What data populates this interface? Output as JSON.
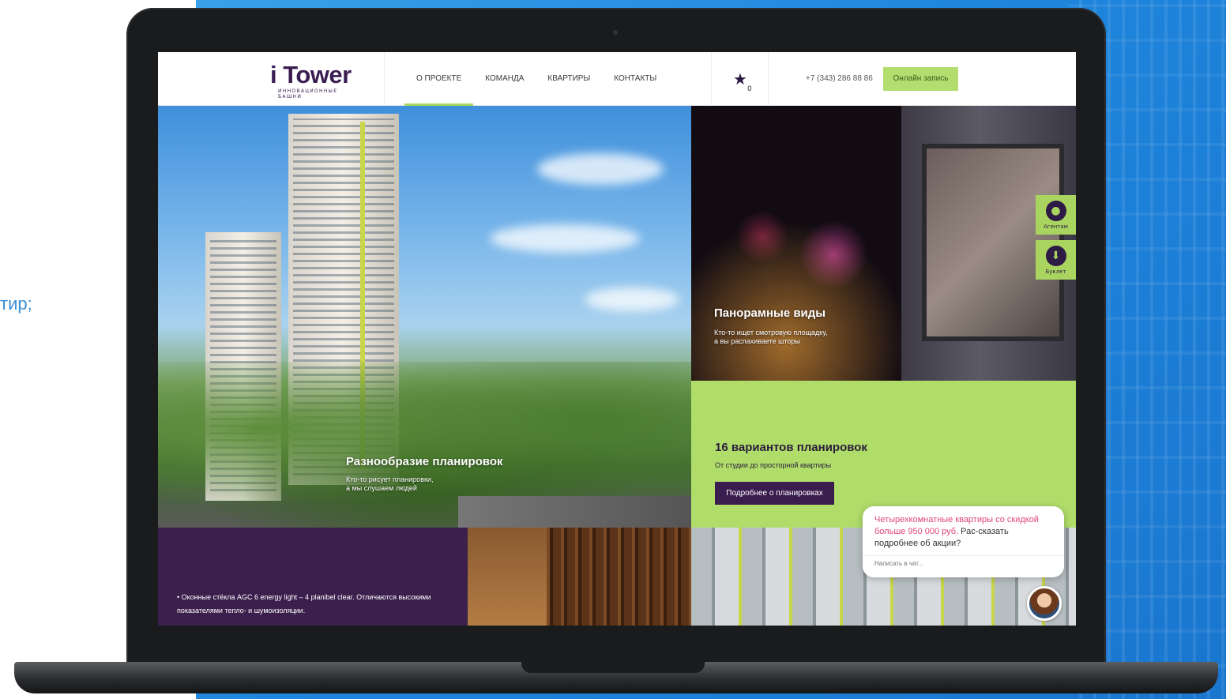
{
  "backdrop": {
    "side_text": "тир;"
  },
  "header": {
    "logo_title": "i Tower",
    "logo_subtitle": "ИННОВАЦИОННЫЕ БАШНИ",
    "nav": [
      {
        "label": "О ПРОЕКТЕ",
        "active": true
      },
      {
        "label": "КОМАНДА",
        "active": false
      },
      {
        "label": "КВАРТИРЫ",
        "active": false
      },
      {
        "label": "КОНТАКТЫ",
        "active": false
      }
    ],
    "favorites_count": "0",
    "phone": "+7 (343) 286 88 86",
    "cta_label": "Онлайн запись"
  },
  "tiles": {
    "layouts": {
      "title": "Разнообразие планировок",
      "text_line1": "Кто-то рисует планировки,",
      "text_line2": "а мы слушаем людей"
    },
    "panorama": {
      "title": "Панорамные виды",
      "text_line1": "Кто-то ищет смотровую площадку,",
      "text_line2": "а вы распахиваете шторы"
    },
    "variants": {
      "title": "16 вариантов планировок",
      "subtitle": "От студии до просторной квартиры",
      "button_label": "Подробнее о планировках"
    },
    "windows": {
      "bullet_text": "•   Оконные стёкла AGC 6 energy light – 4 planibel clear. Отличаются высокими показателями тепло- и шумоизоляции."
    }
  },
  "side_widgets": {
    "agents_label": "Агентам",
    "booklet_label": "Буклет"
  },
  "chat": {
    "message_highlight": "Четырехкомнатные квартиры со скидкой больше 950 000 руб.",
    "message_rest": " Рас-сказать подробнее об акции?",
    "input_placeholder": "Написать в чат..."
  },
  "colors": {
    "accent_green": "#b0dd6a",
    "brand_purple": "#3b1d52",
    "chat_highlight": "#e0457b",
    "backdrop_blue": "#1f86dd"
  }
}
